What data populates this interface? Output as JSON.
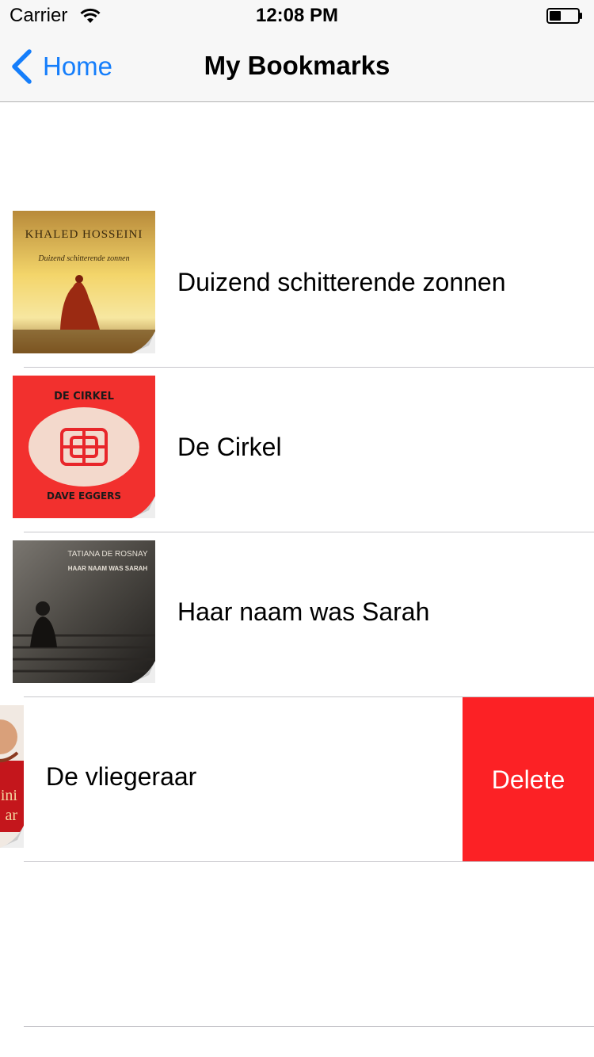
{
  "status_bar": {
    "carrier": "Carrier",
    "time": "12:08 PM",
    "wifi_icon": "wifi-icon",
    "battery_icon": "battery-icon"
  },
  "nav": {
    "back_label": "Home",
    "back_icon": "chevron-left-icon",
    "title": "My Bookmarks"
  },
  "colors": {
    "accent": "#157efb",
    "delete": "#fc2125",
    "separator": "#c8c7cc"
  },
  "bookmarks": [
    {
      "title": "Duizend schitterende zonnen",
      "cover": {
        "author": "KHALED HOSSEINI",
        "book_title": "Duizend schitterende zonnen"
      }
    },
    {
      "title": "De Cirkel",
      "cover": {
        "author": "DAVE EGGERS",
        "book_title": "DE CIRKEL"
      }
    },
    {
      "title": "Haar naam was Sarah",
      "cover": {
        "author": "TATIANA DE ROSNAY",
        "book_title": "HAAR NAAM WAS SARAH"
      }
    },
    {
      "title": "De vliegeraar",
      "swiped": true,
      "delete_label": "Delete"
    }
  ]
}
